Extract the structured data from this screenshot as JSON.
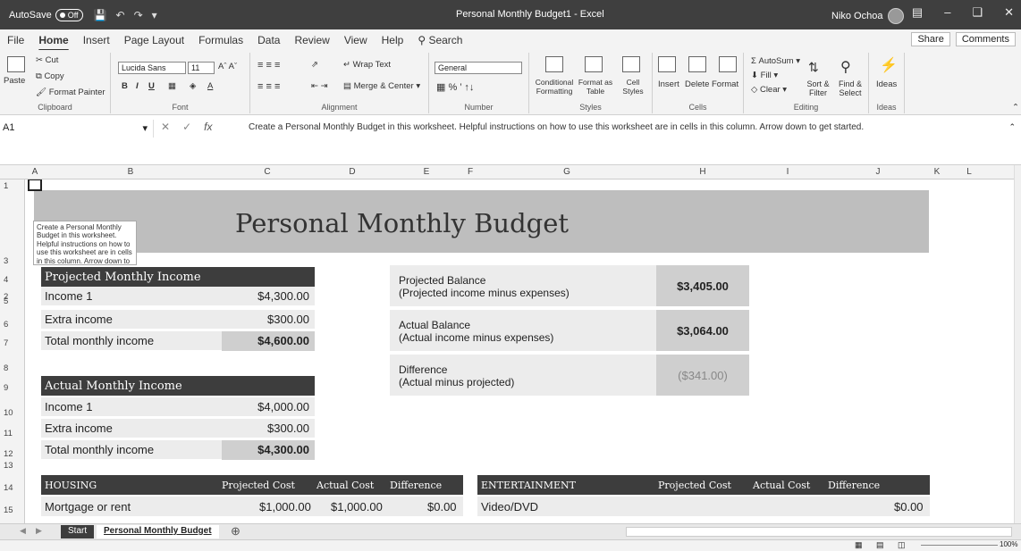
{
  "titlebar": {
    "autosave_label": "AutoSave",
    "autosave_state": "Off",
    "doc_title": "Personal Monthly Budget1  -  Excel",
    "user_name": "Niko Ochoa"
  },
  "menu": {
    "tabs": [
      "File",
      "Home",
      "Insert",
      "Page Layout",
      "Formulas",
      "Data",
      "Review",
      "View",
      "Help"
    ],
    "search": "Search",
    "share": "Share",
    "comments": "Comments"
  },
  "ribbon": {
    "clipboard": {
      "paste": "Paste",
      "cut": "Cut",
      "copy": "Copy",
      "format_painter": "Format Painter",
      "label": "Clipboard"
    },
    "font": {
      "name": "Lucida Sans",
      "size": "11",
      "label": "Font"
    },
    "alignment": {
      "wrap": "Wrap Text",
      "merge": "Merge & Center",
      "label": "Alignment"
    },
    "number": {
      "format": "General",
      "label": "Number"
    },
    "styles": {
      "conditional": "Conditional Formatting",
      "format_table": "Format as Table",
      "cell_styles": "Cell Styles",
      "label": "Styles"
    },
    "cells": {
      "insert": "Insert",
      "delete": "Delete",
      "format": "Format",
      "label": "Cells"
    },
    "editing": {
      "autosum": "AutoSum",
      "fill": "Fill",
      "clear": "Clear",
      "sort": "Sort & Filter",
      "find": "Find & Select",
      "label": "Editing"
    },
    "ideas": {
      "btn": "Ideas",
      "label": "Ideas"
    }
  },
  "formula": {
    "name_box": "A1",
    "fx": "fx",
    "content": "Create a Personal Monthly Budget in this worksheet. Helpful instructions on how to use this worksheet are in cells in this column. Arrow down to get started."
  },
  "columns": [
    "A",
    "B",
    "C",
    "D",
    "E",
    "F",
    "G",
    "H",
    "I",
    "J",
    "K",
    "L"
  ],
  "rows": [
    "1",
    "2",
    "3",
    "4",
    "5",
    "6",
    "7",
    "8",
    "9",
    "10",
    "11",
    "12",
    "13",
    "14",
    "15"
  ],
  "sheet": {
    "title": "Personal Monthly Budget",
    "tooltip": "Create a Personal Monthly Budget in this worksheet. Helpful instructions on how to use this worksheet are in cells in this column. Arrow down to get started.",
    "projected": {
      "header": "Projected Monthly Income",
      "income1_label": "Income 1",
      "income1": "$4,300.00",
      "extra_label": "Extra income",
      "extra": "$300.00",
      "total_label": "Total monthly income",
      "total": "$4,600.00"
    },
    "actual": {
      "header": "Actual Monthly Income",
      "income1_label": "Income 1",
      "income1": "$4,000.00",
      "extra_label": "Extra income",
      "extra": "$300.00",
      "total_label": "Total monthly income",
      "total": "$4,300.00"
    },
    "balances": [
      {
        "l1": "Projected Balance",
        "l2": "(Projected income minus expenses)",
        "value": "$3,405.00"
      },
      {
        "l1": "Actual Balance",
        "l2": "(Actual income minus expenses)",
        "value": "$3,064.00"
      },
      {
        "l1": "Difference",
        "l2": "(Actual minus projected)",
        "value": "($341.00)"
      }
    ],
    "housing": {
      "header": "HOUSING",
      "c1": "Projected Cost",
      "c2": "Actual Cost",
      "c3": "Difference",
      "r1_label": "Mortgage or rent",
      "r1_proj": "$1,000.00",
      "r1_act": "$1,000.00",
      "r1_diff": "$0.00"
    },
    "entertainment": {
      "header": "ENTERTAINMENT",
      "c1": "Projected Cost",
      "c2": "Actual Cost",
      "c3": "Difference",
      "r1_label": "Video/DVD",
      "r1_diff": "$0.00"
    }
  },
  "sheet_tabs": [
    "Start",
    "Personal Monthly Budget"
  ],
  "status": {
    "zoom": "100%"
  }
}
